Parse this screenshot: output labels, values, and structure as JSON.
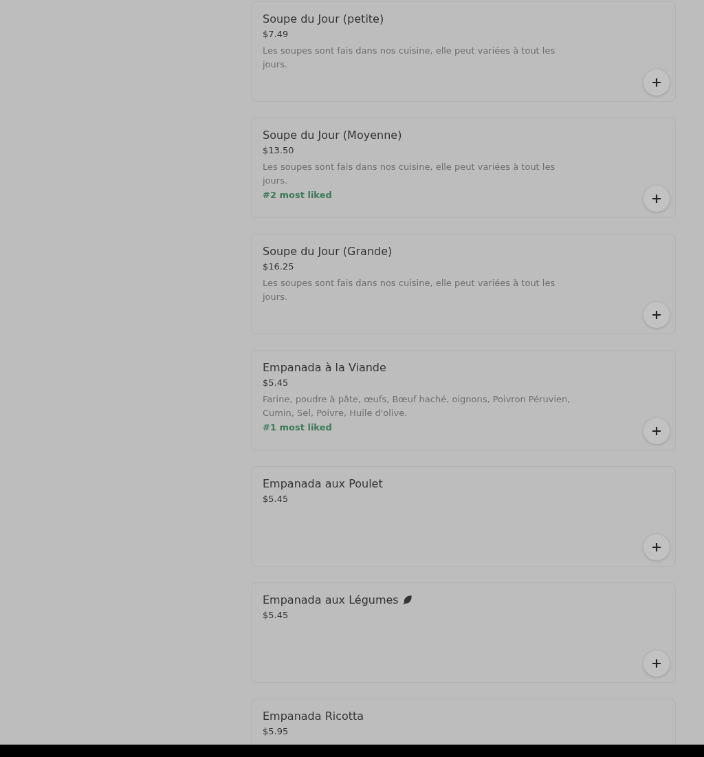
{
  "items": [
    {
      "name": "Soupe du Jour (petite)",
      "price": "$7.49",
      "description": "Les soupes sont fais dans nos cuisine, elle peut variées à tout les jours.",
      "vegetarian": false,
      "add_button": true
    },
    {
      "name": "Soupe du Jour (Moyenne)",
      "price": "$13.50",
      "description": "Les soupes sont fais dans nos cuisine, elle peut variées à tout les jours.",
      "badge": "#2 most liked",
      "vegetarian": false,
      "add_button": true
    },
    {
      "name": "Soupe du Jour (Grande)",
      "price": "$16.25",
      "description": "Les soupes sont fais dans nos cuisine, elle peut variées à tout les jours.",
      "vegetarian": false,
      "add_button": true
    },
    {
      "name": "Empanada à la Viande",
      "price": "$5.45",
      "description": "Farine, poudre à pâte, œufs, Bœuf haché, oignons, Poivron Péruvien, Cumin, Sel, Poivre, Huile d'olive.",
      "badge": "#1 most liked",
      "vegetarian": false,
      "add_button": true
    },
    {
      "name": "Empanada aux Poulet",
      "price": "$5.45",
      "vegetarian": false,
      "add_button": true
    },
    {
      "name": "Empanada aux Légumes",
      "price": "$5.45",
      "vegetarian": true,
      "add_button": true
    },
    {
      "name": "Empanada Ricotta",
      "price": "$5.95",
      "vegetarian": false
    }
  ]
}
